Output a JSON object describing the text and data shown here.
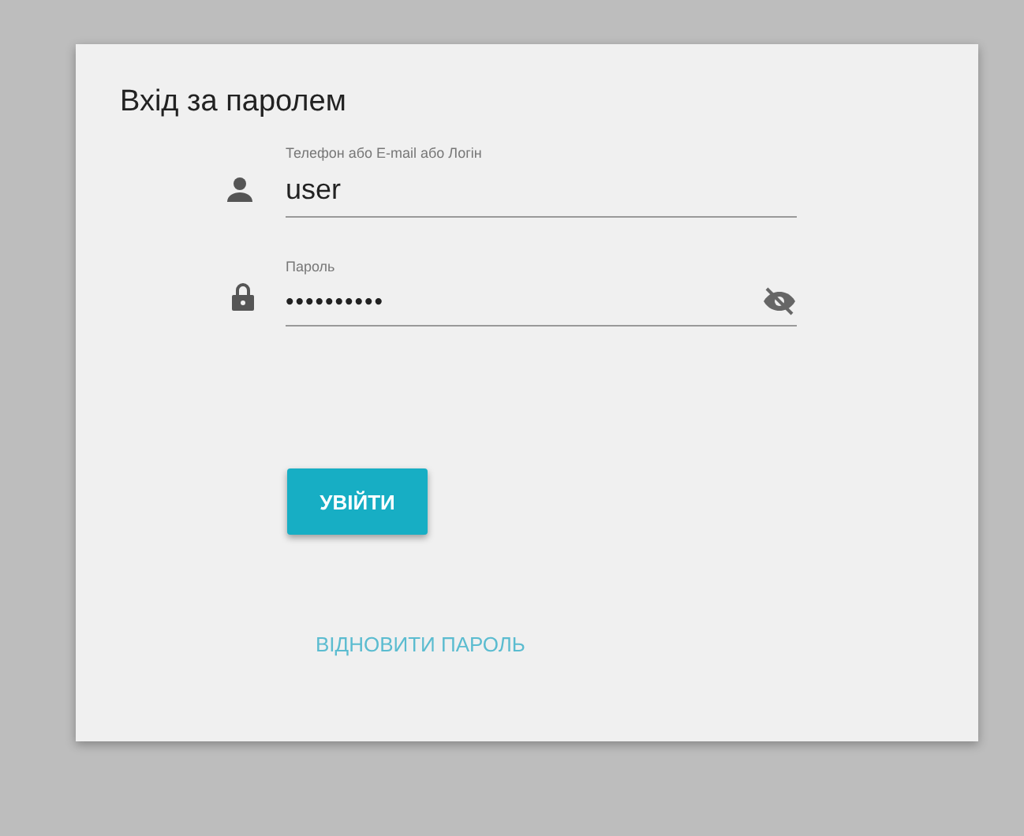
{
  "title": "Вхід за паролем",
  "fields": [
    {
      "kind": "user",
      "label": "Телефон або E-mail або Логін",
      "value": "user"
    },
    {
      "kind": "password",
      "label": "Пароль",
      "value": "••••••••••"
    }
  ],
  "submit_button": "УВІЙТИ",
  "restore_link": "ВІДНОВИТИ ПАРОЛЬ"
}
